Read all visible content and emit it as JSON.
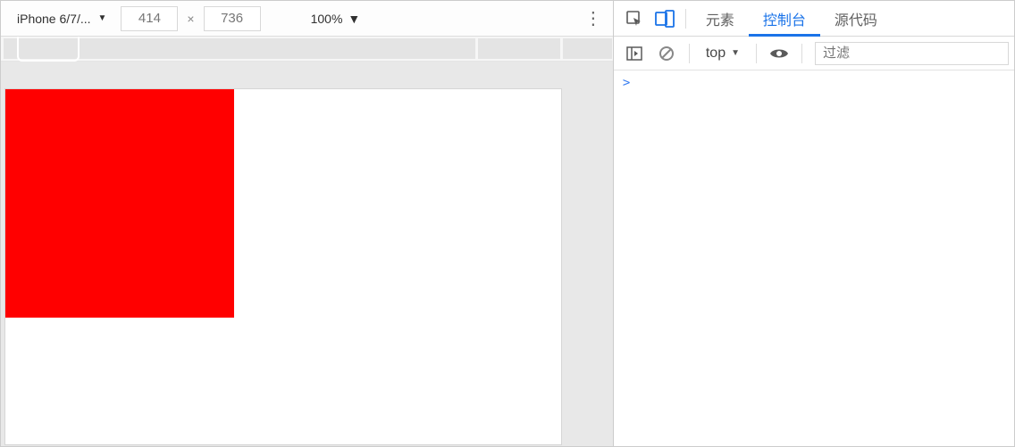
{
  "device_toolbar": {
    "device_name": "iPhone 6/7/...",
    "width": "414",
    "height": "736",
    "zoom": "100%"
  },
  "content": {
    "red_box_color": "#ff0000"
  },
  "devtools": {
    "tabs": {
      "elements": "元素",
      "console": "控制台",
      "sources": "源代码"
    },
    "context_label": "top",
    "filter_placeholder": "过滤",
    "prompt": ">"
  }
}
